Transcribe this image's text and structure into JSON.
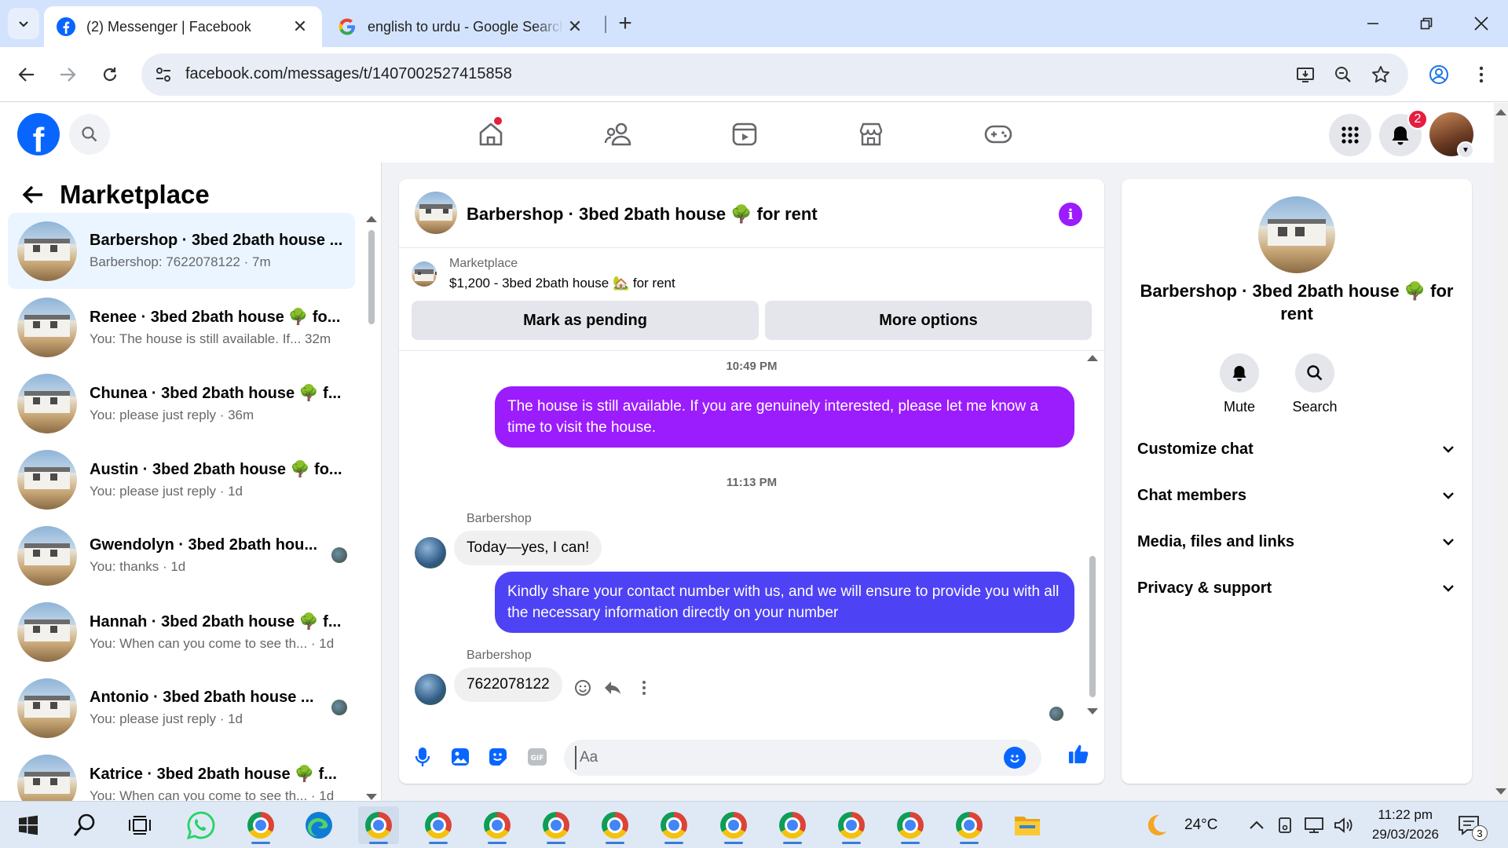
{
  "browser": {
    "tabs": [
      {
        "title": "(2) Messenger | Facebook",
        "active": true
      },
      {
        "title": "english to urdu - Google Search",
        "active": false
      }
    ],
    "url": "facebook.com/messages/t/1407002527415858"
  },
  "fb_header": {
    "logo_letter": "f",
    "notification_count": "2"
  },
  "left_panel": {
    "title": "Marketplace",
    "conversations": [
      {
        "name": "Barbershop · 3bed 2bath house ...",
        "sub": "Barbershop: 7622078122 · 7m"
      },
      {
        "name": "Renee · 3bed 2bath house 🌳 fo...",
        "sub": "You: The house is still available. If... 32m"
      },
      {
        "name": "Chunea · 3bed 2bath house 🌳 f...",
        "sub": "You: please just reply · 36m"
      },
      {
        "name": "Austin · 3bed 2bath house 🌳 fo...",
        "sub": "You: please just reply · 1d"
      },
      {
        "name": "Gwendolyn · 3bed 2bath hou...",
        "sub": "You: thanks · 1d"
      },
      {
        "name": "Hannah · 3bed 2bath house 🌳 f...",
        "sub": "You: When can you come to see th... · 1d"
      },
      {
        "name": "Antonio · 3bed 2bath house ...",
        "sub": "You: please just reply · 1d"
      },
      {
        "name": "Katrice · 3bed 2bath house 🌳 f...",
        "sub": "You: When can you come to see th... · 1d"
      }
    ]
  },
  "chat": {
    "title": "Barbershop · 3bed 2bath house 🌳 for rent",
    "listing": {
      "source": "Marketplace",
      "price_title": "$1,200 - 3bed 2bath house 🏡 for rent",
      "mark_pending": "Mark as pending",
      "more_options": "More options"
    },
    "messages": {
      "ts1": "10:49 PM",
      "out1": "The house is still available. If you are genuinely interested, please let me know a time to visit the house.",
      "ts2": "11:13 PM",
      "sender1": "Barbershop",
      "in1": "Today—yes, I can!",
      "out2": "Kindly share your contact number with us, and we will ensure to provide you with all the necessary information directly on your number",
      "sender2": "Barbershop",
      "in2": "7622078122"
    },
    "composer_placeholder": "Aa",
    "colors": {
      "out1": "#9b1cfc",
      "out2": "#4e42f5",
      "accent": "#0866ff"
    }
  },
  "info_panel": {
    "name": "Barbershop · 3bed 2bath house 🌳 for rent",
    "mute": "Mute",
    "search": "Search",
    "sections": [
      "Customize chat",
      "Chat members",
      "Media, files and links",
      "Privacy & support"
    ]
  },
  "taskbar": {
    "weather": "24°C",
    "time": "11:22 pm",
    "date": "29/03/2026",
    "notification_count": "3"
  }
}
